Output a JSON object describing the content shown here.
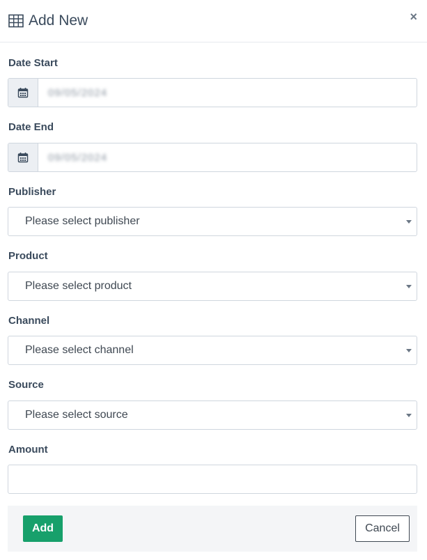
{
  "modal": {
    "title": "Add New",
    "close_label": "×"
  },
  "fields": {
    "date_start": {
      "label": "Date Start",
      "value": "09/05/2024"
    },
    "date_end": {
      "label": "Date End",
      "value": "09/05/2024"
    },
    "publisher": {
      "label": "Publisher",
      "placeholder": "Please select publisher"
    },
    "product": {
      "label": "Product",
      "placeholder": "Please select product"
    },
    "channel": {
      "label": "Channel",
      "placeholder": "Please select channel"
    },
    "source": {
      "label": "Source",
      "placeholder": "Please select source"
    },
    "amount": {
      "label": "Amount",
      "value": ""
    }
  },
  "footer": {
    "add_label": "Add",
    "cancel_label": "Cancel"
  },
  "colors": {
    "primary": "#17a06b",
    "text": "#3a4a5c",
    "border": "#cfd6de",
    "addon_bg": "#eceff3",
    "footer_bg": "#f4f5f7"
  },
  "icons": {
    "header": "table-grid-icon",
    "date": "calendar-icon",
    "select": "caret-down-icon",
    "close": "close-icon"
  }
}
